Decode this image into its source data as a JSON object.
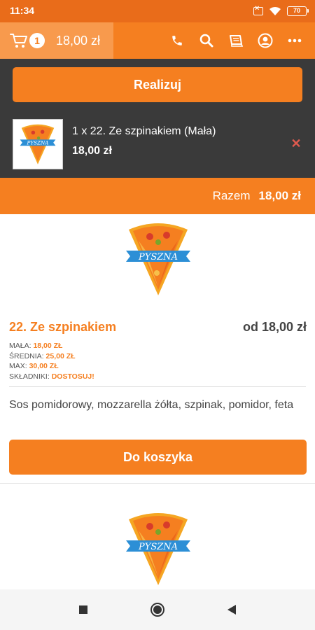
{
  "status_bar": {
    "time": "11:34",
    "battery": "70"
  },
  "header": {
    "cart_count": "1",
    "cart_total": "18,00 zł",
    "icons": [
      "phone-icon",
      "search-icon",
      "menu-book-icon",
      "user-icon",
      "more-icon"
    ]
  },
  "cart": {
    "checkout_label": "Realizuj",
    "item": {
      "name": "1 x 22. Ze szpinakiem (Mała)",
      "price": "18,00 zł"
    },
    "total_label": "Razem",
    "total_value": "18,00 zł"
  },
  "logo": {
    "text": "PYSZNA"
  },
  "product": {
    "name": "22. Ze szpinakiem",
    "from_price": "od 18,00 zł",
    "sizes": [
      {
        "label": "MAŁA:",
        "value": "18,00 ZŁ"
      },
      {
        "label": "ŚREDNIA:",
        "value": "25,00 ZŁ"
      },
      {
        "label": "MAX:",
        "value": "30,00 ZŁ"
      },
      {
        "label": "SKŁADNIKI:",
        "value": "DOSTOSUJ!"
      }
    ],
    "description": "Sos pomidorowy, mozzarella żółta, szpinak, pomidor, feta",
    "add_label": "Do koszyka"
  },
  "colors": {
    "accent": "#f57f20",
    "dark_panel": "#3a3a3a",
    "remove": "#e05a4f"
  }
}
